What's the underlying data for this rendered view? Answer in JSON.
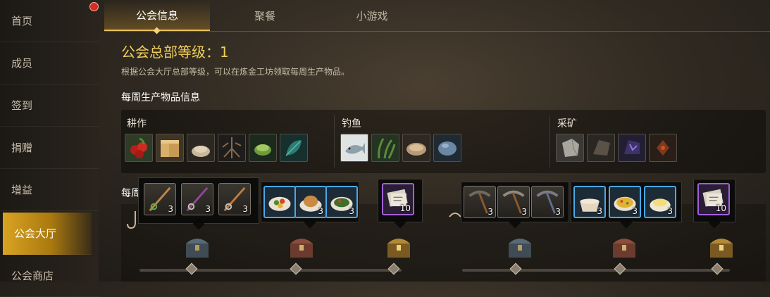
{
  "sidebar": {
    "items": [
      {
        "label": "首页"
      },
      {
        "label": "成员"
      },
      {
        "label": "签到"
      },
      {
        "label": "捐赠"
      },
      {
        "label": "增益"
      },
      {
        "label": "公会大厅"
      },
      {
        "label": "公会商店"
      }
    ],
    "active_index": 5
  },
  "tabs": [
    {
      "label": "公会信息"
    },
    {
      "label": "聚餐"
    },
    {
      "label": "小游戏"
    }
  ],
  "guild": {
    "level_title": "公会总部等级：1",
    "description": "根据公会大厅总部等级，可以在炼金工坊领取每周生产物品。",
    "weekly_section_title": "每周生产物品信息",
    "milestone_label": "每周"
  },
  "groups": [
    {
      "label": "耕作",
      "icons": [
        "apple-icon",
        "wood-planks-icon",
        "grain-icon",
        "roots-icon",
        "herb-bowl-icon",
        "teal-leaf-icon"
      ]
    },
    {
      "label": "钓鱼",
      "icons": [
        "fish-icon",
        "seaweed-icon",
        "shell-icon",
        "blue-stone-icon"
      ]
    },
    {
      "label": "采矿",
      "icons": [
        "stone-block-icon",
        "dark-ore-icon",
        "purple-ore-icon",
        "red-gem-icon"
      ]
    }
  ],
  "rewards": {
    "fishing_rods": [
      {
        "qty": "3"
      },
      {
        "qty": "3"
      },
      {
        "qty": "3"
      }
    ],
    "dishes_left": [
      {
        "qty": ""
      },
      {
        "qty": "3"
      },
      {
        "qty": "3"
      }
    ],
    "ticket_left": {
      "qty": "10"
    },
    "pickaxes": [
      {
        "qty": "3"
      },
      {
        "qty": "3"
      },
      {
        "qty": "3"
      }
    ],
    "dishes_right": [
      {
        "qty": "3"
      },
      {
        "qty": "3"
      },
      {
        "qty": "3"
      }
    ],
    "ticket_right": {
      "qty": "10"
    }
  },
  "colors": {
    "accent_gold": "#f1cf5b",
    "active_tab_border": "#e9c25a",
    "notification_red": "#d82b22",
    "rare_blue": "#4aa8e6",
    "epic_purple": "#a261d6"
  }
}
